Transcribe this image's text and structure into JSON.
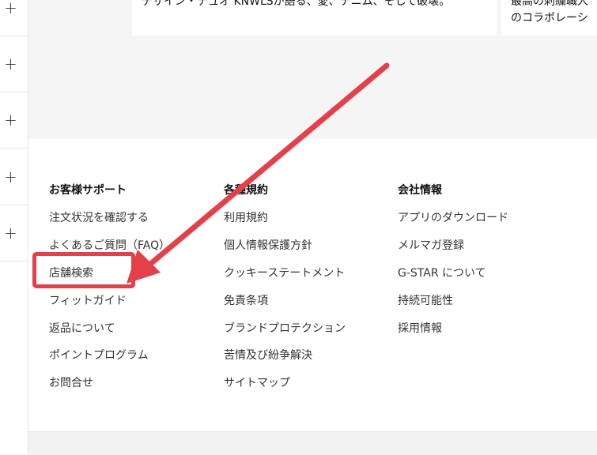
{
  "top_cards": [
    {
      "text": "デザイン・デュオ KNWLSが語る、愛、デニム、そして破壊。"
    },
    {
      "line1": "最高の刺繍職人",
      "line2": "のコラボレーシ"
    }
  ],
  "footer": {
    "columns": [
      {
        "heading": "お客様サポート",
        "links": [
          "注文状況を確認する",
          "よくあるご質問（FAQ）",
          "店舗検索",
          "フィットガイド",
          "返品について",
          "ポイントプログラム",
          "お問合せ"
        ]
      },
      {
        "heading": "各種規約",
        "links": [
          "利用規約",
          "個人情報保護方針",
          "クッキーステートメント",
          "免責条項",
          "ブランドプロテクション",
          "苦情及び紛争解決",
          "サイトマップ"
        ]
      },
      {
        "heading": "会社情報",
        "links": [
          "アプリのダウンロード",
          "メルマガ登録",
          "G-STAR について",
          "持続可能性",
          "採用情報"
        ]
      }
    ]
  },
  "annotation": {
    "color": "#e5404a",
    "target": "店舗検索"
  },
  "rail_icons": [
    "plus-icon",
    "plus-icon",
    "plus-icon",
    "plus-icon",
    "plus-icon"
  ]
}
